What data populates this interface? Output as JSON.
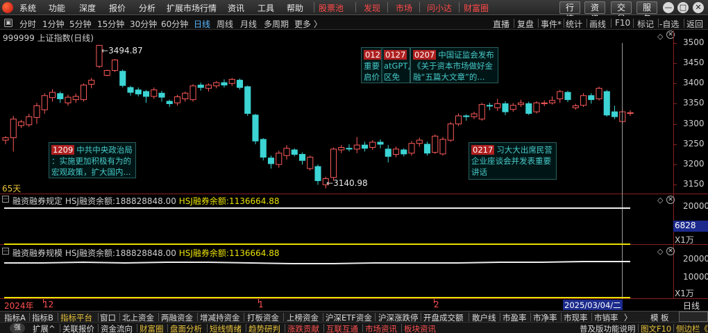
{
  "menu": {
    "items": [
      "系统",
      "功能",
      "深度",
      "报价",
      "分析",
      "扩展市场行情",
      "资讯",
      "工具",
      "帮助"
    ],
    "hot": [
      "股票池",
      "发现",
      "市场",
      "问小达",
      "财富圈"
    ],
    "right_buttons": [
      "行情",
      "资讯",
      "交易",
      "服务"
    ]
  },
  "periods": {
    "items": [
      "分时",
      "1分钟",
      "5分钟",
      "15分钟",
      "30分钟",
      "60分钟",
      "日线",
      "周线",
      "月线",
      "多周期",
      "更多 〉"
    ],
    "active": "日线"
  },
  "toolbar": {
    "items": [
      "直播",
      "复盘",
      "事件*",
      "统计",
      "画线",
      "F10",
      "标记",
      "-自选",
      "返回"
    ]
  },
  "main_chart": {
    "title": "999999 上证指数(日线)",
    "high_label": "3494.87",
    "low_label": "3140.98",
    "days_label": "65天",
    "y_ticks": [
      "3500",
      "3450",
      "3400",
      "3350",
      "3300",
      "3250",
      "3200",
      "3150"
    ]
  },
  "news": [
    {
      "tag": "1209",
      "lines": [
        "中共中央政治局",
        "：实施更加积极有为的",
        "宏观政策，扩大国内..."
      ]
    },
    {
      "tag": "012",
      "lines": [
        "重要",
        "启价"
      ]
    },
    {
      "tag": "0127",
      "lines": [
        "atGPT,",
        "区免费"
      ]
    },
    {
      "tag": "0207",
      "lines": [
        "中国证监会发布",
        "《关于资本市场做好金",
        "融“五篇大文章”的..."
      ]
    },
    {
      "tag": "0217",
      "lines": [
        "习大大出席民营",
        "企业座谈会并发表重要",
        "讲话"
      ]
    }
  ],
  "panel1": {
    "title": "融资融券规定",
    "label_a": "HSJ融资余额:",
    "value_a": "188828848.00",
    "label_b": "HSJ融券余额:",
    "value_b": "1136664.88",
    "y_tick": "20000",
    "box": "6828",
    "unit": "X1万"
  },
  "panel2": {
    "title": "融资融券规模",
    "label_a": "HSJ融资余额:",
    "value_a": "188828848.00",
    "label_b": "HSJ融券余额:",
    "value_b": "1136664.88",
    "y_ticks": [
      "20000",
      "10000"
    ],
    "unit": "X1万"
  },
  "timeaxis": {
    "labels": [
      "2024年",
      "12",
      "1",
      "2"
    ],
    "cursor_date": "2025/03/04/二",
    "period": "日线"
  },
  "tabs1": {
    "items": [
      "指标A",
      "指标B",
      "指标平台",
      "窗口",
      "北上资金",
      "两融资金",
      "增减持资金",
      "打板资金",
      "上榜资金",
      "沪深ETF资金",
      "沪深涨跌停",
      "开盘成交额",
      "散户线",
      "市盈率",
      "市净率",
      "市现率",
      "市销率",
      "〉"
    ],
    "active": "指标平台",
    "right": [
      "模",
      "板"
    ]
  },
  "tabs2": {
    "items": [
      "扩展^",
      "关联报价",
      "资金流向",
      "财富圈",
      "盘面分析",
      "短线情绪",
      "趋势研判",
      "涨跌贡献",
      "互联互通",
      "市场资讯",
      "板块资讯"
    ],
    "yellow": [
      "财富圈",
      "盘面分析",
      "短线情绪",
      "趋势研判"
    ],
    "red": [
      "涨跌贡献",
      "互联互通",
      "市场资讯",
      "板块资讯"
    ],
    "right": [
      "普及版功能说明",
      "图文F10",
      "侧边栏《"
    ],
    "badge": "强"
  },
  "colors": {
    "up": "#ff5a5a",
    "down": "#3cd4d4",
    "highlight": "#e8c23a",
    "grid": "#8a2020"
  },
  "chart_data": {
    "type": "candlestick",
    "title": "999999 上证指数(日线)",
    "ylim": [
      3130,
      3510
    ],
    "candles": [
      [
        3260,
        3266,
        3250,
        3270
      ],
      [
        3266,
        3312,
        3232,
        3320
      ],
      [
        3296,
        3305,
        3290,
        3310
      ],
      [
        3298,
        3318,
        3293,
        3325
      ],
      [
        3316,
        3345,
        3300,
        3352
      ],
      [
        3335,
        3370,
        3325,
        3376
      ],
      [
        3365,
        3378,
        3355,
        3386
      ],
      [
        3375,
        3362,
        3352,
        3380
      ],
      [
        3352,
        3366,
        3345,
        3372
      ],
      [
        3360,
        3368,
        3352,
        3375
      ],
      [
        3360,
        3396,
        3355,
        3400
      ],
      [
        3398,
        3408,
        3388,
        3414
      ],
      [
        3442,
        3494,
        3438,
        3494
      ],
      [
        3420,
        3432,
        3418,
        3434
      ],
      [
        3432,
        3458,
        3428,
        3460
      ],
      [
        3430,
        3395,
        3390,
        3434
      ],
      [
        3390,
        3378,
        3370,
        3394
      ],
      [
        3384,
        3374,
        3368,
        3390
      ],
      [
        3380,
        3368,
        3352,
        3384
      ],
      [
        3368,
        3384,
        3362,
        3390
      ],
      [
        3376,
        3366,
        3355,
        3382
      ],
      [
        3356,
        3350,
        3342,
        3360
      ],
      [
        3352,
        3367,
        3345,
        3372
      ],
      [
        3362,
        3376,
        3355,
        3380
      ],
      [
        3360,
        3394,
        3355,
        3398
      ],
      [
        3396,
        3390,
        3382,
        3402
      ],
      [
        3388,
        3396,
        3380,
        3400
      ],
      [
        3394,
        3402,
        3388,
        3406
      ],
      [
        3402,
        3396,
        3390,
        3410
      ],
      [
        3400,
        3410,
        3394,
        3414
      ],
      [
        3408,
        3390,
        3385,
        3412
      ],
      [
        3392,
        3326,
        3320,
        3395
      ],
      [
        3322,
        3258,
        3250,
        3325
      ],
      [
        3262,
        3218,
        3210,
        3265
      ],
      [
        3216,
        3202,
        3190,
        3222
      ],
      [
        3200,
        3228,
        3192,
        3234
      ],
      [
        3222,
        3240,
        3212,
        3248
      ],
      [
        3236,
        3225,
        3220,
        3240
      ],
      [
        3225,
        3210,
        3200,
        3230
      ],
      [
        3190,
        3218,
        3185,
        3222
      ],
      [
        3195,
        3160,
        3150,
        3200
      ],
      [
        3150,
        3165,
        3141,
        3170
      ],
      [
        3168,
        3238,
        3160,
        3242
      ],
      [
        3236,
        3242,
        3228,
        3248
      ],
      [
        3240,
        3238,
        3232,
        3250
      ],
      [
        3238,
        3248,
        3228,
        3268
      ],
      [
        3248,
        3240,
        3232,
        3256
      ],
      [
        3242,
        3255,
        3236,
        3260
      ],
      [
        3255,
        3250,
        3240,
        3262
      ],
      [
        3238,
        3220,
        3205,
        3248
      ],
      [
        3225,
        3238,
        3218,
        3244
      ],
      [
        3236,
        3226,
        3220,
        3240
      ],
      [
        3228,
        3252,
        3222,
        3258
      ],
      [
        3252,
        3260,
        3244,
        3266
      ],
      [
        3250,
        3228,
        3222,
        3256
      ],
      [
        3230,
        3270,
        3226,
        3274
      ],
      [
        3226,
        3262,
        3222,
        3268
      ],
      [
        3260,
        3300,
        3256,
        3305
      ],
      [
        3300,
        3320,
        3295,
        3326
      ],
      [
        3320,
        3318,
        3308,
        3324
      ],
      [
        3318,
        3325,
        3312,
        3330
      ],
      [
        3312,
        3348,
        3308,
        3352
      ],
      [
        3346,
        3344,
        3334,
        3352
      ],
      [
        3340,
        3350,
        3332,
        3362
      ],
      [
        3350,
        3330,
        3322,
        3356
      ],
      [
        3336,
        3346,
        3330,
        3352
      ],
      [
        3348,
        3352,
        3342,
        3360
      ],
      [
        3350,
        3326,
        3322,
        3355
      ],
      [
        3330,
        3352,
        3326,
        3356
      ],
      [
        3350,
        3352,
        3344,
        3358
      ],
      [
        3352,
        3358,
        3348,
        3368
      ],
      [
        3362,
        3380,
        3352,
        3384
      ],
      [
        3378,
        3360,
        3354,
        3382
      ],
      [
        3340,
        3345,
        3335,
        3350
      ],
      [
        3346,
        3370,
        3342,
        3376
      ],
      [
        3370,
        3360,
        3350,
        3376
      ],
      [
        3362,
        3388,
        3358,
        3392
      ],
      [
        3380,
        3322,
        3318,
        3384
      ],
      [
        3330,
        3318,
        3312,
        3345
      ],
      [
        3306,
        3330,
        3300,
        3336
      ],
      [
        3326,
        3328,
        3320,
        3334
      ]
    ]
  }
}
